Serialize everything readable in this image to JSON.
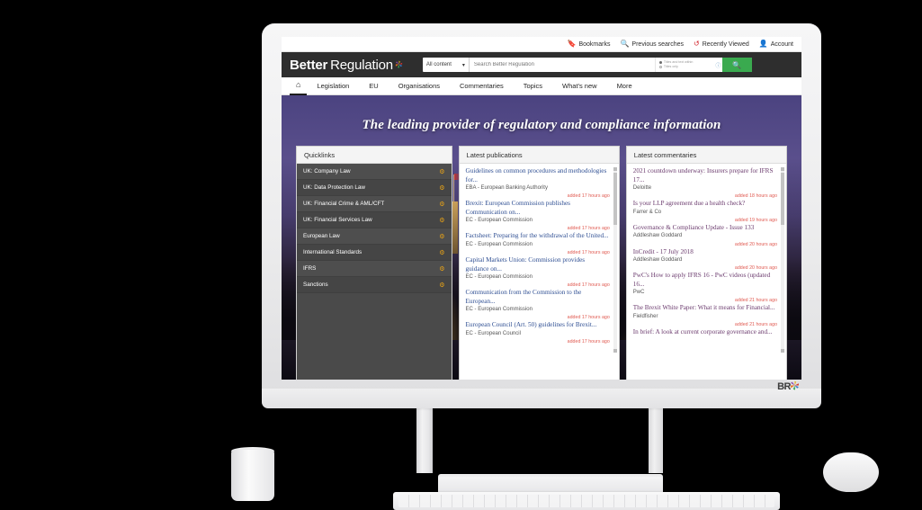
{
  "utility_bar": [
    {
      "label": "Bookmarks",
      "icon": "bookmark-icon",
      "glyph": "⚑"
    },
    {
      "label": "Previous searches",
      "icon": "search-history-icon",
      "glyph": "◌"
    },
    {
      "label": "Recently Viewed",
      "icon": "clock-rewind-icon",
      "glyph": "↺"
    },
    {
      "label": "Account",
      "icon": "user-icon",
      "glyph": "●"
    }
  ],
  "brand": {
    "word1": "Better",
    "word2": "Regulation",
    "mark": "asterisk-logo"
  },
  "search": {
    "scope_selected": "All content",
    "placeholder": "Search Better Regulation",
    "radio_1": "Titles and text within",
    "radio_2": "Titles only",
    "radio_selected": 1,
    "info_label": "i",
    "button_icon": "search-icon"
  },
  "nav": [
    {
      "label": "⌂",
      "name": "home",
      "active": true
    },
    {
      "label": "Legislation",
      "name": "legislation",
      "active": false
    },
    {
      "label": "EU",
      "name": "eu",
      "active": false
    },
    {
      "label": "Organisations",
      "name": "organisations",
      "active": false
    },
    {
      "label": "Commentaries",
      "name": "commentaries",
      "active": false
    },
    {
      "label": "Topics",
      "name": "topics",
      "active": false
    },
    {
      "label": "What's new",
      "name": "whats-new",
      "active": false
    },
    {
      "label": "More",
      "name": "more",
      "active": false
    }
  ],
  "hero": {
    "title": "The leading provider of regulatory and compliance information"
  },
  "quicklinks": {
    "title": "Quicklinks",
    "items": [
      {
        "label": "UK: Company Law"
      },
      {
        "label": "UK: Data Protection Law"
      },
      {
        "label": "UK: Financial Crime & AML/CFT"
      },
      {
        "label": "UK: Financial Services Law"
      },
      {
        "label": "European Law"
      },
      {
        "label": "International Standards"
      },
      {
        "label": "IFRS"
      },
      {
        "label": "Sanctions"
      }
    ]
  },
  "publications": {
    "title": "Latest publications",
    "items": [
      {
        "title": "Guidelines on common procedures and methodologies for...",
        "source": "EBA - European Banking Authority",
        "added": "added 17 hours ago"
      },
      {
        "title": "Brexit: European Commission publishes Communication on...",
        "source": "EC - European Commission",
        "added": "added 17 hours ago"
      },
      {
        "title": "Factsheet: Preparing for the withdrawal of the United...",
        "source": "EC - European Commission",
        "added": "added 17 hours ago"
      },
      {
        "title": "Capital Markets Union: Commission provides guidance on...",
        "source": "EC - European Commission",
        "added": "added 17 hours ago"
      },
      {
        "title": "Communication from the Commission to the European...",
        "source": "EC - European Commission",
        "added": "added 17 hours ago"
      },
      {
        "title": "European Council (Art. 50) guidelines for Brexit...",
        "source": "EC - European Council",
        "added": "added 17 hours ago"
      }
    ]
  },
  "commentaries": {
    "title": "Latest commentaries",
    "items": [
      {
        "title": "2021 countdown underway: Insurers prepare for IFRS 17...",
        "source": "Deloitte",
        "added": "added 18 hours ago"
      },
      {
        "title": "Is your LLP agreement due a health check?",
        "source": "Farrer & Co",
        "added": "added 19 hours ago"
      },
      {
        "title": "Governance & Compliance Update - Issue 133",
        "source": "Addleshaw Goddard",
        "added": "added 20 hours ago"
      },
      {
        "title": "InCredit - 17 July 2018",
        "source": "Addleshaw Goddard",
        "added": "added 20 hours ago"
      },
      {
        "title": "PwC's How to apply IFRS 16 - PwC videos (updated 16...",
        "source": "PwC",
        "added": "added 21 hours ago"
      },
      {
        "title": "The Brexit White Paper: What it means for Financial...",
        "source": "Fieldfisher",
        "added": "added 21 hours ago"
      },
      {
        "title": "In brief: A look at current corporate governance and...",
        "source": "",
        "added": ""
      }
    ]
  },
  "monitor": {
    "chin_logo": "BR"
  },
  "colors": {
    "header_bg": "#2e2e2e",
    "search_button": "#3aaa4f",
    "link_blue": "#2f4f93",
    "link_purple": "#6b3b6e",
    "date_red": "#e05b52",
    "gear_gold": "#e8a317",
    "util_red": "#d2232a"
  }
}
